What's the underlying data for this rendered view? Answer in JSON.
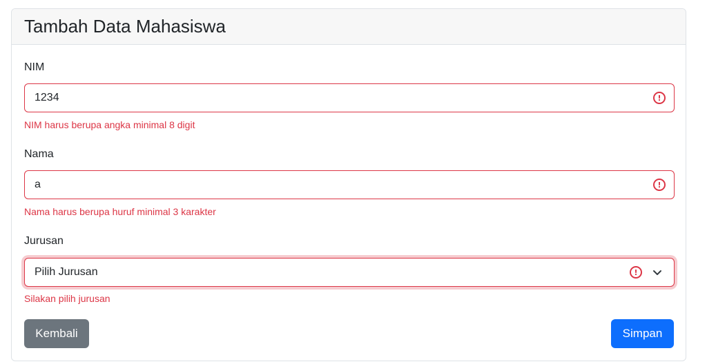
{
  "card": {
    "title": "Tambah Data Mahasiswa"
  },
  "form": {
    "nim": {
      "label": "NIM",
      "value": "1234",
      "error": "NIM harus berupa angka minimal 8 digit"
    },
    "nama": {
      "label": "Nama",
      "value": "a",
      "error": "Nama harus berupa huruf minimal 3 karakter"
    },
    "jurusan": {
      "label": "Jurusan",
      "selected": "Pilih Jurusan",
      "error": "Silakan pilih jurusan"
    },
    "invalid_mark": "!"
  },
  "buttons": {
    "back_label": "Kembali",
    "save_label": "Simpan"
  },
  "colors": {
    "danger": "#dc3545",
    "primary": "#0d6efd",
    "secondary": "#6c757d"
  },
  "icons": {
    "invalid": "exclamation-circle-icon",
    "select": "chevron-down-icon"
  }
}
